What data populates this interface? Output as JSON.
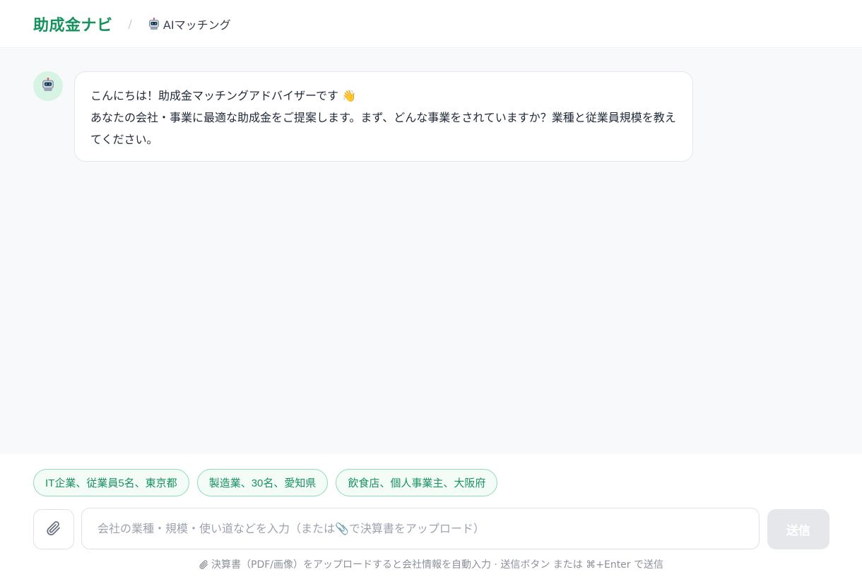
{
  "header": {
    "brand": "助成金ナビ",
    "separator": "/",
    "breadcrumb_label": "AIマッチング",
    "breadcrumb_icon": "robot-icon"
  },
  "chat": {
    "messages": [
      {
        "sender": "assistant",
        "avatar_icon": "robot-icon",
        "lines": [
          "こんにちは！助成金マッチングアドバイザーです 👋",
          "あなたの会社・事業に最適な助成金をご提案します。まず、どんな事業をされていますか？業種と従業員規模を教えてください。"
        ]
      }
    ]
  },
  "suggestions": [
    "IT企業、従業員5名、東京都",
    "製造業、30名、愛知県",
    "飲食店、個人事業主、大阪府"
  ],
  "composer": {
    "attach_icon": "paperclip-icon",
    "placeholder": "会社の業種・規模・使い道などを入力（または📎で決算書をアップロード）",
    "send_label": "送信",
    "hint": "決算書（PDF/画像）をアップロードすると会社情報を自動入力 · 送信ボタン または ⌘+Enter で送信"
  },
  "colors": {
    "brand": "#16925e",
    "chip_border": "#8fdcb6",
    "avatar_bg": "#d6f3e4",
    "send_disabled": "#e5e7eb"
  }
}
